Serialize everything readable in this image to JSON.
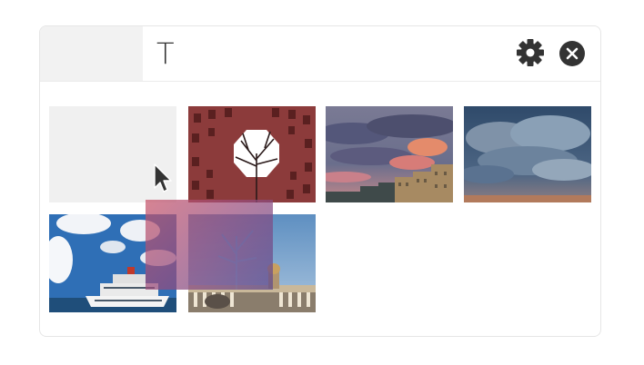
{
  "toolbar": {
    "text_tool_glyph": "T",
    "settings_icon": "gear-icon",
    "close_icon": "close-icon"
  },
  "gallery": {
    "items": [
      {
        "kind": "placeholder",
        "state": "empty (dragged out)"
      },
      {
        "kind": "photo",
        "icon": "courtyard-tree-photo"
      },
      {
        "kind": "photo",
        "icon": "sunset-clouds-city-photo"
      },
      {
        "kind": "photo",
        "icon": "storm-clouds-photo"
      },
      {
        "kind": "photo",
        "icon": "cruise-ship-sky-photo"
      },
      {
        "kind": "photo",
        "icon": "plaza-sky-photo"
      }
    ],
    "drag_preview": {
      "state": "dragging"
    }
  },
  "colors": {
    "accent_dark": "#333333",
    "placeholder_bg": "#f0f0f0",
    "header_tab_bg": "#f2f2f2"
  }
}
